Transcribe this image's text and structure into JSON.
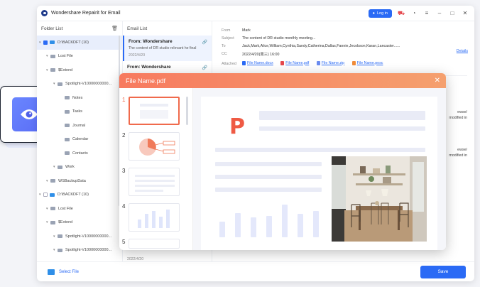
{
  "app": {
    "title": "Wondershare Repairit for Email",
    "login_label": "Log in",
    "icons": [
      "cart-icon",
      "headset-icon",
      "menu-icon",
      "minimize-icon",
      "maximize-icon",
      "close-icon"
    ]
  },
  "sidebar": {
    "title": "Folder List",
    "tree": [
      {
        "label": "D:\\BACKDFT (10)",
        "level": 0,
        "checked": true,
        "selected": true,
        "folder_color": "#2f8fe8"
      },
      {
        "label": "Lost File",
        "level": 1
      },
      {
        "label": "$Extend",
        "level": 1
      },
      {
        "label": "Spotlight-V10000000000...",
        "level": 2
      },
      {
        "label": "Notes",
        "level": 3
      },
      {
        "label": "Tasks",
        "level": 3
      },
      {
        "label": "Journal",
        "level": 3
      },
      {
        "label": "Calendar",
        "level": 3
      },
      {
        "label": "Contacts",
        "level": 3
      },
      {
        "label": "Work",
        "level": 2
      },
      {
        "label": "WSBackupData",
        "level": 1
      },
      {
        "label": "D:\\BACKDFT (10)",
        "level": 0,
        "checked": false,
        "folder_color": "#2f8fe8"
      },
      {
        "label": "Lost File",
        "level": 1
      },
      {
        "label": "$Extend",
        "level": 1
      },
      {
        "label": "Spotlight-V10000000000...",
        "level": 2
      },
      {
        "label": "Spotlight-V10000000000...",
        "level": 2
      }
    ]
  },
  "maillist": {
    "title": "Email List",
    "items": [
      {
        "from": "From: Wondershare",
        "preview": "The content of DR studio  relevant he final",
        "date": "2022/4/20"
      },
      {
        "from": "From: Wondershare",
        "preview": "",
        "date": ""
      }
    ],
    "bottom_date": "2022/4/20"
  },
  "detail": {
    "rows": [
      {
        "key": "From",
        "value": "Mark"
      },
      {
        "key": "Subject",
        "value": "The content of DR studio monthly meeting..."
      },
      {
        "key": "To",
        "value": "Jack,Mark,Alice,William,Cynthia,Sandy,Catherina,Dallas,Fannie,Jecobson,Karan,Lancaster......"
      },
      {
        "key": "CC",
        "value": "2022/4/20(周三) 16:00"
      }
    ],
    "details_link": "Details",
    "attached_label": "Attached",
    "attachments": [
      {
        "name": "File Name.docx",
        "type": "doc"
      },
      {
        "name": "File Name.pdf",
        "type": "pdf"
      },
      {
        "name": "File Name.zip",
        "type": "zip"
      },
      {
        "name": "File Name.posc",
        "type": "posc"
      }
    ],
    "snippets": [
      "ewse/",
      "modified in",
      "ewse/",
      "modified in"
    ]
  },
  "bottom": {
    "select_file_label": "Select File",
    "save_label": "Save"
  },
  "pdf_viewer": {
    "title": "File Name.pdf",
    "pages": [
      "1",
      "2",
      "3",
      "4",
      "5"
    ],
    "selected_page": 1,
    "chart_bars": [
      0.45,
      0.7,
      0.58,
      0.62,
      0.95,
      0.68,
      0.78
    ]
  },
  "colors": {
    "accent": "#2a6af5",
    "pdf_header": "#f77a5f",
    "pdf_logo": "#ef5a44"
  }
}
